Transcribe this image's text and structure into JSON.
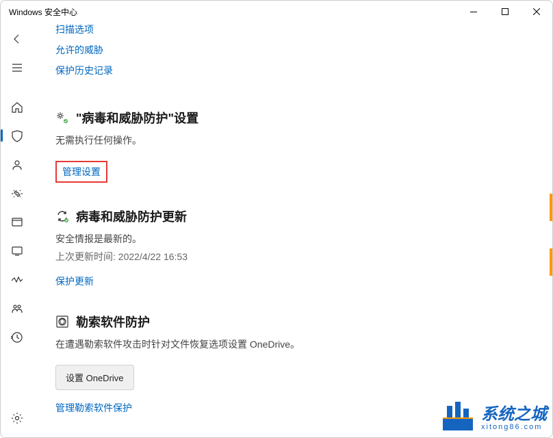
{
  "window": {
    "title": "Windows 安全中心"
  },
  "topLinks": {
    "scanOptions": "扫描选项",
    "allowedThreats": "允许的威胁",
    "protectionHistory": "保护历史记录"
  },
  "sections": {
    "settings": {
      "title": "\"病毒和威胁防护\"设置",
      "desc": "无需执行任何操作。",
      "link": "管理设置"
    },
    "updates": {
      "title": "病毒和威胁防护更新",
      "desc": "安全情报是最新的。",
      "meta": "上次更新时间: 2022/4/22 16:53",
      "link": "保护更新"
    },
    "ransomware": {
      "title": "勒索软件防护",
      "desc": "在遭遇勒索软件攻击时针对文件恢复选项设置 OneDrive。",
      "button": "设置 OneDrive",
      "link": "管理勒索软件保护"
    }
  },
  "watermark": {
    "brand": "系统之城",
    "url": "xitong86.com"
  }
}
